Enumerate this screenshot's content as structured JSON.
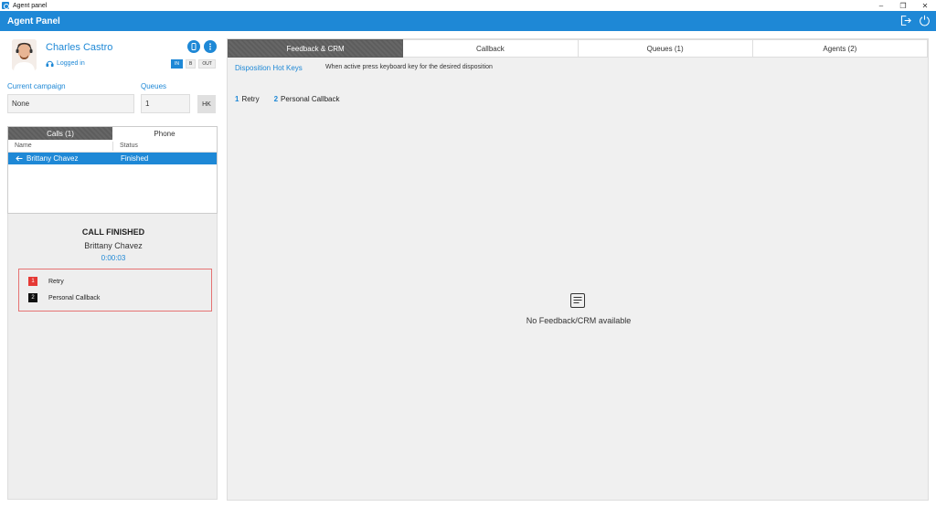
{
  "window": {
    "title": "Agent panel",
    "minimize": "–",
    "restore": "❐",
    "close": "✕"
  },
  "header": {
    "title": "Agent Panel"
  },
  "agent": {
    "name": "Charles Castro",
    "status": "Logged in",
    "direction_buttons": [
      "IN",
      "B",
      "OUT"
    ],
    "active_direction": "IN"
  },
  "campaign": {
    "label": "Current campaign",
    "value": "None"
  },
  "queues_field": {
    "label": "Queues",
    "value": "1",
    "hk_button": "HK"
  },
  "calls": {
    "tabs": [
      "Calls (1)",
      "Phone"
    ],
    "active_tab": "Calls (1)",
    "columns": [
      "Name",
      "Status"
    ],
    "rows": [
      {
        "name": "Brittany Chavez",
        "status": "Finished"
      }
    ]
  },
  "call_panel": {
    "state": "CALL FINISHED",
    "contact": "Brittany Chavez",
    "timer": "0:00:03",
    "dispositions": [
      {
        "key": "1",
        "label": "Retry",
        "color": "#e53935"
      },
      {
        "key": "2",
        "label": "Personal Callback",
        "color": "#111111"
      }
    ]
  },
  "right": {
    "tabs": [
      "Feedback & CRM",
      "Callback",
      "Queues (1)",
      "Agents (2)"
    ],
    "active_tab": "Feedback & CRM",
    "hotkeys_label": "Disposition Hot Keys",
    "hotkeys_desc": "When active press keyboard key for the desired disposition",
    "hotkeys": [
      {
        "key": "1",
        "label": "Retry"
      },
      {
        "key": "2",
        "label": "Personal Callback"
      }
    ],
    "empty_icon": "document-icon",
    "empty_text": "No Feedback/CRM available"
  },
  "colors": {
    "accent": "#1e88d6",
    "tab_active": "#5d5d5d",
    "disposition_border": "#e57373"
  }
}
